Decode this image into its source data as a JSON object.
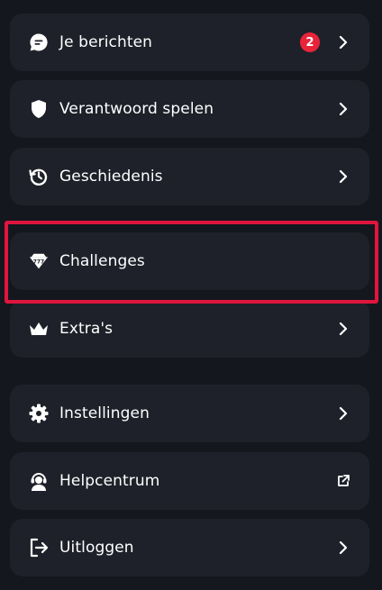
{
  "menu": {
    "items": [
      {
        "label": "Je berichten",
        "icon": "chat-icon",
        "badge": "2",
        "trailing": "chevron-right-icon"
      },
      {
        "label": "Verantwoord spelen",
        "icon": "shield-icon",
        "trailing": "chevron-right-icon"
      },
      {
        "label": "Geschiedenis",
        "icon": "history-icon",
        "trailing": "chevron-right-icon"
      },
      {
        "label": "Challenges",
        "icon": "challenges-icon",
        "trailing": "none",
        "highlighted": true
      },
      {
        "label": "Extra's",
        "icon": "crown-icon",
        "trailing": "chevron-right-icon"
      },
      {
        "label": "Instellingen",
        "icon": "gear-icon",
        "trailing": "chevron-right-icon"
      },
      {
        "label": "Helpcentrum",
        "icon": "support-agent-icon",
        "trailing": "external-link-icon"
      },
      {
        "label": "Uitloggen",
        "icon": "logout-icon",
        "trailing": "chevron-right-icon"
      }
    ]
  },
  "colors": {
    "background": "#14171e",
    "item_background": "#1e2129",
    "badge": "#e8243b",
    "highlight_border": "#e0153d",
    "text": "#ffffff"
  }
}
